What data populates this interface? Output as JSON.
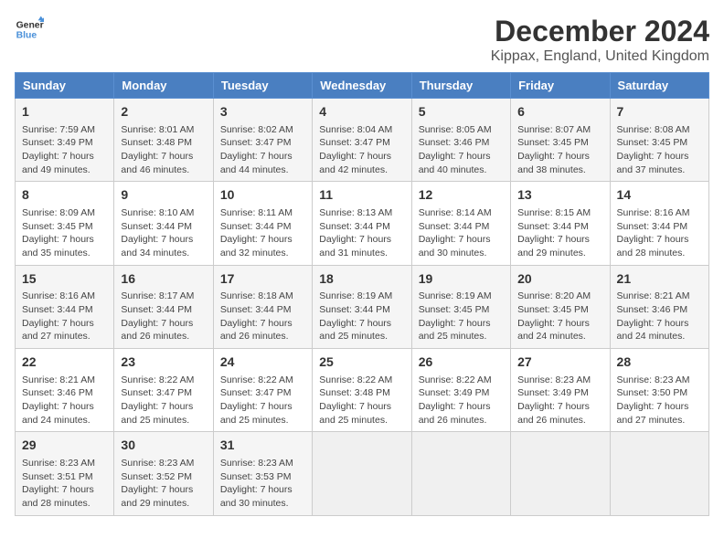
{
  "header": {
    "logo_line1": "General",
    "logo_line2": "Blue",
    "title": "December 2024",
    "subtitle": "Kippax, England, United Kingdom"
  },
  "columns": [
    "Sunday",
    "Monday",
    "Tuesday",
    "Wednesday",
    "Thursday",
    "Friday",
    "Saturday"
  ],
  "weeks": [
    [
      {
        "day": "1",
        "info": "Sunrise: 7:59 AM\nSunset: 3:49 PM\nDaylight: 7 hours and 49 minutes."
      },
      {
        "day": "2",
        "info": "Sunrise: 8:01 AM\nSunset: 3:48 PM\nDaylight: 7 hours and 46 minutes."
      },
      {
        "day": "3",
        "info": "Sunrise: 8:02 AM\nSunset: 3:47 PM\nDaylight: 7 hours and 44 minutes."
      },
      {
        "day": "4",
        "info": "Sunrise: 8:04 AM\nSunset: 3:47 PM\nDaylight: 7 hours and 42 minutes."
      },
      {
        "day": "5",
        "info": "Sunrise: 8:05 AM\nSunset: 3:46 PM\nDaylight: 7 hours and 40 minutes."
      },
      {
        "day": "6",
        "info": "Sunrise: 8:07 AM\nSunset: 3:45 PM\nDaylight: 7 hours and 38 minutes."
      },
      {
        "day": "7",
        "info": "Sunrise: 8:08 AM\nSunset: 3:45 PM\nDaylight: 7 hours and 37 minutes."
      }
    ],
    [
      {
        "day": "8",
        "info": "Sunrise: 8:09 AM\nSunset: 3:45 PM\nDaylight: 7 hours and 35 minutes."
      },
      {
        "day": "9",
        "info": "Sunrise: 8:10 AM\nSunset: 3:44 PM\nDaylight: 7 hours and 34 minutes."
      },
      {
        "day": "10",
        "info": "Sunrise: 8:11 AM\nSunset: 3:44 PM\nDaylight: 7 hours and 32 minutes."
      },
      {
        "day": "11",
        "info": "Sunrise: 8:13 AM\nSunset: 3:44 PM\nDaylight: 7 hours and 31 minutes."
      },
      {
        "day": "12",
        "info": "Sunrise: 8:14 AM\nSunset: 3:44 PM\nDaylight: 7 hours and 30 minutes."
      },
      {
        "day": "13",
        "info": "Sunrise: 8:15 AM\nSunset: 3:44 PM\nDaylight: 7 hours and 29 minutes."
      },
      {
        "day": "14",
        "info": "Sunrise: 8:16 AM\nSunset: 3:44 PM\nDaylight: 7 hours and 28 minutes."
      }
    ],
    [
      {
        "day": "15",
        "info": "Sunrise: 8:16 AM\nSunset: 3:44 PM\nDaylight: 7 hours and 27 minutes."
      },
      {
        "day": "16",
        "info": "Sunrise: 8:17 AM\nSunset: 3:44 PM\nDaylight: 7 hours and 26 minutes."
      },
      {
        "day": "17",
        "info": "Sunrise: 8:18 AM\nSunset: 3:44 PM\nDaylight: 7 hours and 26 minutes."
      },
      {
        "day": "18",
        "info": "Sunrise: 8:19 AM\nSunset: 3:44 PM\nDaylight: 7 hours and 25 minutes."
      },
      {
        "day": "19",
        "info": "Sunrise: 8:19 AM\nSunset: 3:45 PM\nDaylight: 7 hours and 25 minutes."
      },
      {
        "day": "20",
        "info": "Sunrise: 8:20 AM\nSunset: 3:45 PM\nDaylight: 7 hours and 24 minutes."
      },
      {
        "day": "21",
        "info": "Sunrise: 8:21 AM\nSunset: 3:46 PM\nDaylight: 7 hours and 24 minutes."
      }
    ],
    [
      {
        "day": "22",
        "info": "Sunrise: 8:21 AM\nSunset: 3:46 PM\nDaylight: 7 hours and 24 minutes."
      },
      {
        "day": "23",
        "info": "Sunrise: 8:22 AM\nSunset: 3:47 PM\nDaylight: 7 hours and 25 minutes."
      },
      {
        "day": "24",
        "info": "Sunrise: 8:22 AM\nSunset: 3:47 PM\nDaylight: 7 hours and 25 minutes."
      },
      {
        "day": "25",
        "info": "Sunrise: 8:22 AM\nSunset: 3:48 PM\nDaylight: 7 hours and 25 minutes."
      },
      {
        "day": "26",
        "info": "Sunrise: 8:22 AM\nSunset: 3:49 PM\nDaylight: 7 hours and 26 minutes."
      },
      {
        "day": "27",
        "info": "Sunrise: 8:23 AM\nSunset: 3:49 PM\nDaylight: 7 hours and 26 minutes."
      },
      {
        "day": "28",
        "info": "Sunrise: 8:23 AM\nSunset: 3:50 PM\nDaylight: 7 hours and 27 minutes."
      }
    ],
    [
      {
        "day": "29",
        "info": "Sunrise: 8:23 AM\nSunset: 3:51 PM\nDaylight: 7 hours and 28 minutes."
      },
      {
        "day": "30",
        "info": "Sunrise: 8:23 AM\nSunset: 3:52 PM\nDaylight: 7 hours and 29 minutes."
      },
      {
        "day": "31",
        "info": "Sunrise: 8:23 AM\nSunset: 3:53 PM\nDaylight: 7 hours and 30 minutes."
      },
      null,
      null,
      null,
      null
    ]
  ]
}
